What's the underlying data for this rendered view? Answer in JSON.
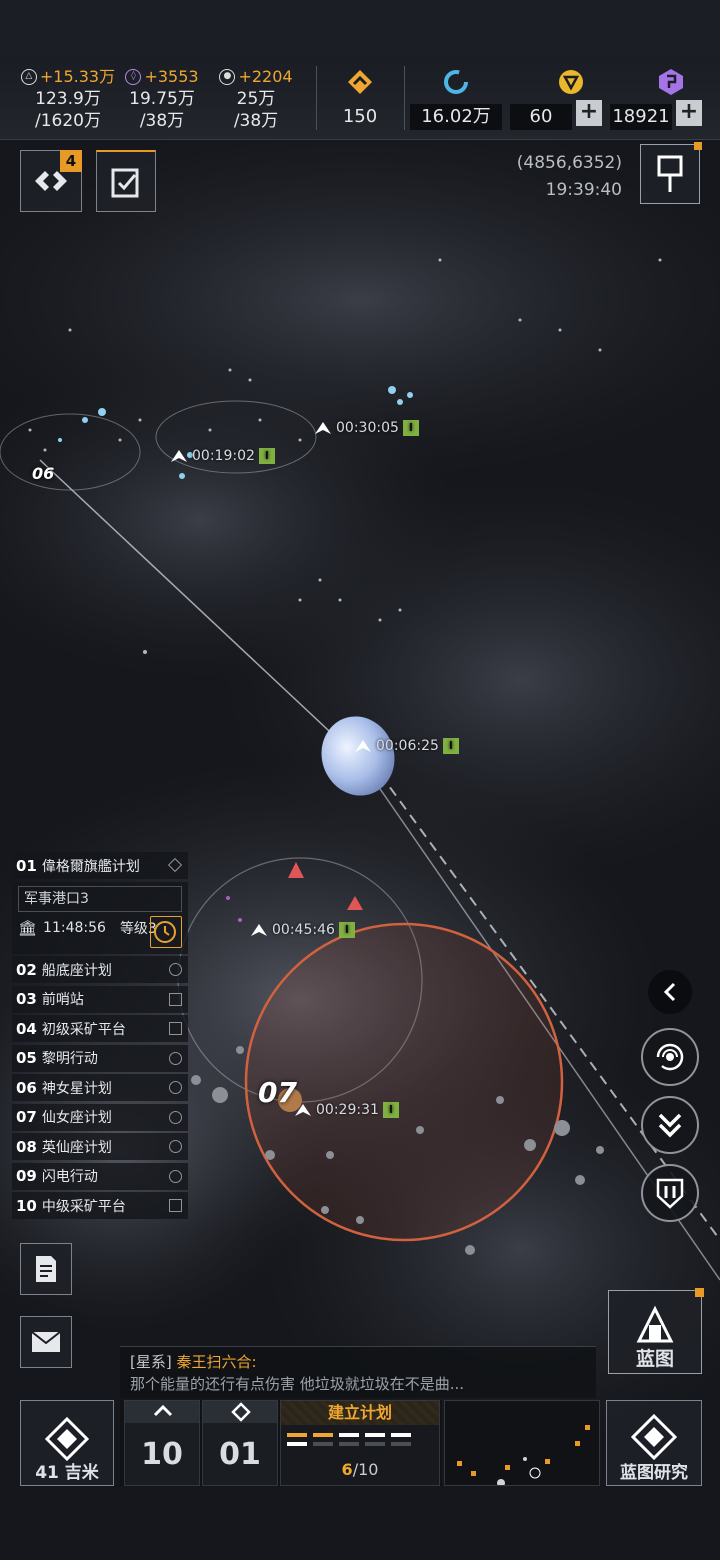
{
  "resources": [
    {
      "icon": "alloy-icon",
      "rate": "+15.33万",
      "amount": "123.9万",
      "cap": "/1620万"
    },
    {
      "icon": "crystal-icon",
      "rate": "+3553",
      "amount": "19.75万",
      "cap": "/38万"
    },
    {
      "icon": "gas-icon",
      "rate": "+2204",
      "amount": "25万",
      "cap": "/38万"
    }
  ],
  "currencies": [
    {
      "icon": "rank-chevron-icon",
      "value": "150",
      "color": "#f0a630"
    },
    {
      "icon": "refresh-cycle-icon",
      "value": "16.02万",
      "color": "#4fb5e6"
    },
    {
      "icon": "gold-triangle-icon",
      "value": "60",
      "color": "#e9b62c",
      "plus": "+"
    },
    {
      "icon": "purple-chip-icon",
      "value": "18921",
      "color": "#a574e8",
      "plus": "+"
    }
  ],
  "top_left": {
    "fleet_badge": "4"
  },
  "coordinates": "(4856,6352)",
  "clock": "19:39:40",
  "map": {
    "timers": [
      {
        "text": "00:19:02"
      },
      {
        "text": "00:30:05"
      },
      {
        "text": "00:06:25"
      },
      {
        "text": "00:45:46"
      },
      {
        "text": "00:29:31"
      }
    ],
    "timer_tag": "I",
    "labels": [
      "06",
      "07"
    ]
  },
  "quests": {
    "first": {
      "num": "01",
      "label": "偉格爾旗艦计划",
      "port": "军事港口3",
      "time": "11:48:56",
      "level": "等级3"
    },
    "items": [
      {
        "num": "02",
        "label": "船底座计划",
        "mark": "circle"
      },
      {
        "num": "03",
        "label": "前哨站",
        "mark": "square"
      },
      {
        "num": "04",
        "label": "初级采矿平台",
        "mark": "square"
      },
      {
        "num": "05",
        "label": "黎明行动",
        "mark": "circle"
      },
      {
        "num": "06",
        "label": "神女星计划",
        "mark": "circle"
      },
      {
        "num": "07",
        "label": "仙女座计划",
        "mark": "circle"
      },
      {
        "num": "08",
        "label": "英仙座计划",
        "mark": "circle"
      },
      {
        "num": "09",
        "label": "闪电行动",
        "mark": "circle"
      },
      {
        "num": "10",
        "label": "中级采矿平台",
        "mark": "square"
      }
    ]
  },
  "chat": {
    "channel": "[星系]",
    "sender": "秦王扫六合:",
    "message": "那个能量的还行有点伤害 他垃圾就垃圾在不是曲..."
  },
  "bottom": {
    "distance": "41 吉米",
    "counter_a": "10",
    "counter_b": "01",
    "plan_title": "建立计划",
    "plan_done": "6",
    "plan_total": "/10",
    "blueprint": "蓝图",
    "blueprint_research": "蓝图研究"
  },
  "accent_color": "#f0a630"
}
